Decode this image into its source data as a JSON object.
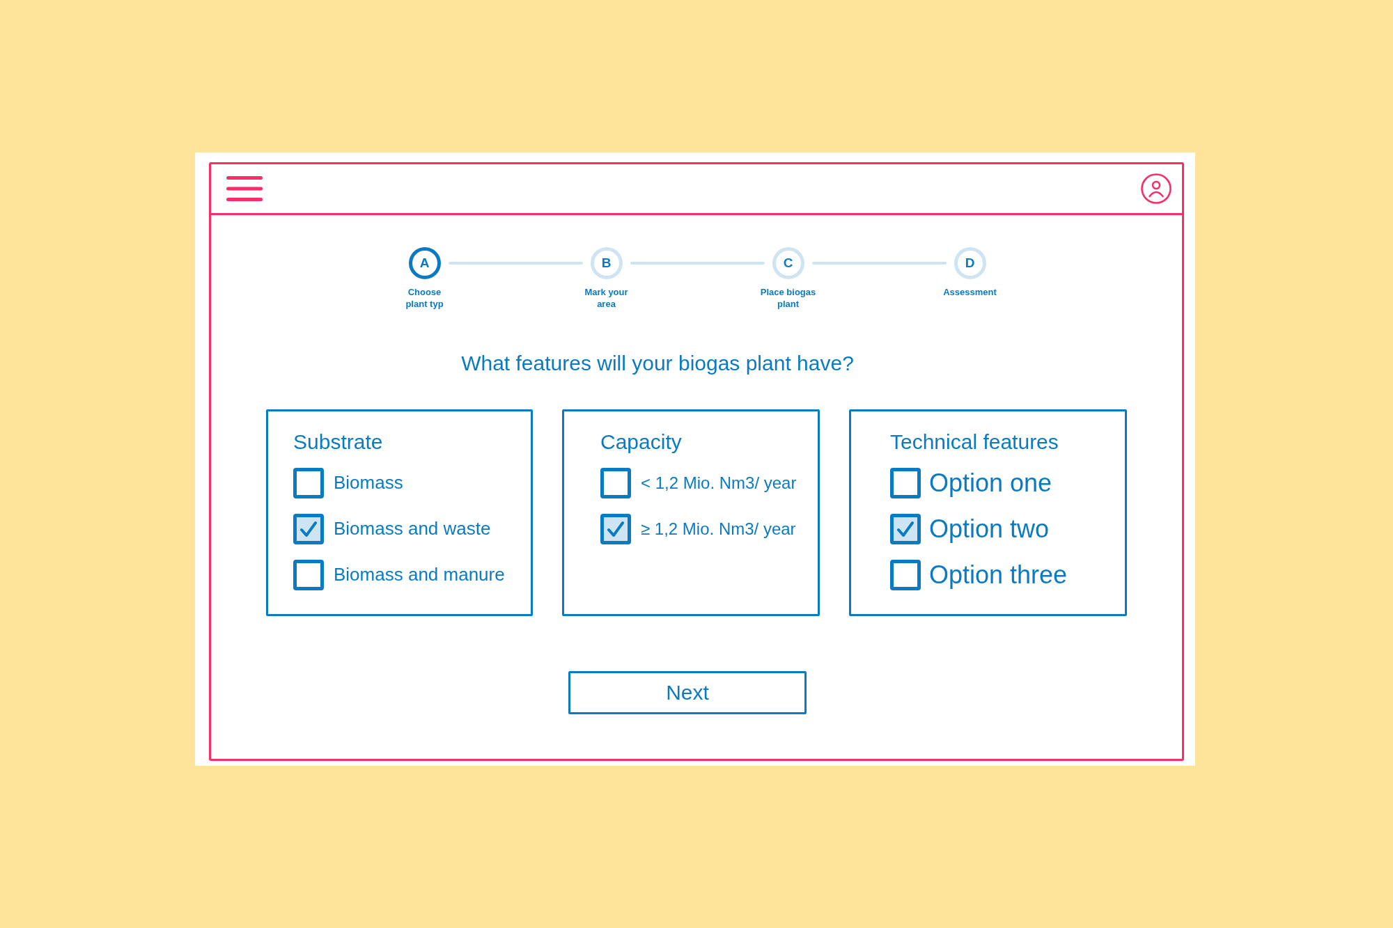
{
  "stepper": {
    "steps": [
      {
        "letter": "A",
        "label": "Choose plant typ",
        "selected": true
      },
      {
        "letter": "B",
        "label": "Mark your area",
        "selected": false
      },
      {
        "letter": "C",
        "label": "Place biogas plant",
        "selected": false
      },
      {
        "letter": "D",
        "label": "Assessment",
        "selected": false
      }
    ]
  },
  "question": "What features will your biogas plant have?",
  "groups": [
    {
      "title": "Substrate",
      "options": [
        {
          "label": "Biomass",
          "checked": false
        },
        {
          "label": "Biomass and waste",
          "checked": true
        },
        {
          "label": "Biomass and manure",
          "checked": false
        }
      ]
    },
    {
      "title": "Capacity",
      "options": [
        {
          "label": "< 1,2 Mio. Nm3/ year",
          "checked": false
        },
        {
          "label": "≥ 1,2 Mio. Nm3/ year",
          "checked": true
        }
      ]
    },
    {
      "title": "Technical features",
      "options": [
        {
          "label": "Option one",
          "checked": false
        },
        {
          "label": "Option two",
          "checked": true
        },
        {
          "label": "Option three",
          "checked": false
        }
      ]
    }
  ],
  "next_button": "Next"
}
